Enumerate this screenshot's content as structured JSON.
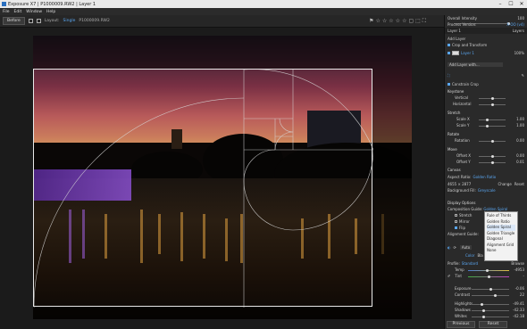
{
  "window": {
    "title": "Exposure X7 | P1000009.RW2 | Layer 1",
    "controls": [
      "–",
      "☐",
      "✕"
    ]
  },
  "menu": [
    "File",
    "Edit",
    "Window",
    "Help"
  ],
  "toolbar": {
    "before_label": "Before",
    "layout_label": "Layout:",
    "layout_value": "Single",
    "filename": "P1000009.RW2"
  },
  "icons": {
    "rating": "star-icon",
    "flag": "flag-icon"
  },
  "panel": {
    "overall_intensity_label": "Overall Intensity",
    "overall_intensity_value": "100",
    "overall_intensity_level": 1.0,
    "process_version_label": "Process Version:",
    "process_version_value": "X-OO (v4)",
    "layer_label": "Layer 1",
    "layers_label": "Layers",
    "add_layer": "Add Layer",
    "crop_layer": "Crop and Transform",
    "layer1_name": "Layer 1",
    "layer1_opacity": "100%",
    "add_layer_with": "Add Layer with...",
    "constrain_crop": "Constrain Crop",
    "keystone": "Keystone",
    "vertical": "Vertical",
    "horizontal": "Horizontal",
    "stretch": "Stretch",
    "scale_x": "Scale X",
    "scale_x_val": "1.00",
    "scale_y": "Scale Y",
    "scale_y_val": "1.00",
    "rotate": "Rotate",
    "rotation": "Rotation",
    "rotation_val": "0.00",
    "move": "Move",
    "offset_x": "Offset X",
    "offset_x_val": "0.00",
    "offset_y": "Offset Y",
    "offset_y_val": "0.01",
    "canvas": "Canvas",
    "aspect_ratio": "Aspect Ratio:",
    "aspect_ratio_val": "Golden Ratio",
    "dims": "4655 × 2877",
    "change": "Change",
    "reset": "Reset",
    "bg_fill": "Background Fill:",
    "bg_fill_val": "Greyscale",
    "display_options": "Display Options",
    "composition_guide": "Composition Guide:",
    "composition_guide_val": "Golden Spiral",
    "stretch_opt": "Stretch",
    "mirror": "Mirror",
    "flip": "Flip",
    "alignment_guide": "Alignment Guide:",
    "auto": "Auto",
    "color_tab": "Color",
    "bw_tab": "Bla",
    "profile": "Profile:",
    "profile_val": "Standard",
    "browse": "Browse",
    "temp": "Temp",
    "temp_val": "-4953",
    "tint": "Tint",
    "tint_val": "-",
    "exposure": "Exposure",
    "exposure_val": "-0.06",
    "contrast": "Contrast",
    "contrast_val": "22",
    "highlights": "Highlights",
    "highlights_val": "-49.41",
    "shadows": "Shadows",
    "shadows_val": "-42.33",
    "whites": "Whites",
    "whites_val": "-42.18",
    "previous": "Previous",
    "reset_btn": "Reset"
  },
  "dropdown": [
    "Rule of Thirds",
    "Golden Ratio",
    "Golden Spiral",
    "Golden Triangle",
    "Diagonal",
    "Alignment Grid",
    "None"
  ],
  "dropdown_selected": "Golden Spiral"
}
